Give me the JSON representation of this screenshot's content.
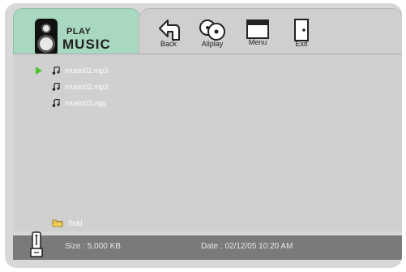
{
  "header": {
    "title_top": "PLAY",
    "title_bottom": "MUSIC"
  },
  "toolbar": {
    "back_label": "Back",
    "allplay_label": "Allplay",
    "menu_label": "Menu",
    "exit_label": "Exit"
  },
  "files": [
    {
      "name": "music01.mp3",
      "selected": true
    },
    {
      "name": "music02.mp3",
      "selected": false
    },
    {
      "name": "music03.ogg",
      "selected": false
    }
  ],
  "current_path": "/hdd",
  "status": {
    "size_text": "Size : 5,000 KB",
    "date_text": "Date : 02/12/05  10:20  AM"
  },
  "colors": {
    "tab_green": "#a9d8c0",
    "selection_arrow": "#4ac72a",
    "status_bar": "#7a7a7a",
    "panel": "#d0d0d0"
  },
  "icons": [
    "speaker-icon",
    "back-icon",
    "allplay-icon",
    "menu-icon",
    "exit-icon",
    "music-note-icon",
    "folder-icon",
    "usb-drive-icon",
    "play-arrow-icon"
  ]
}
